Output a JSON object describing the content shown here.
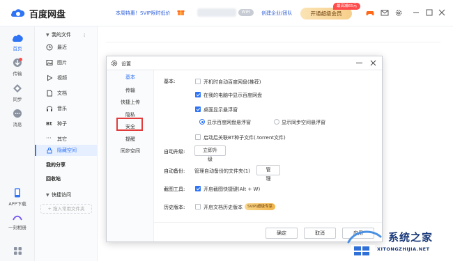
{
  "app": {
    "title": "百度网盘",
    "promo": "本周特惠！SVIP限时低价",
    "wifi_badge": "WIFI",
    "enterprise_link": "创建企业/团队",
    "vip_button": "开通超级会员",
    "discount_badge": "最高减65元",
    "accent_color": "#2f74f5"
  },
  "rail": {
    "items": [
      {
        "label": "首页",
        "icon": "cloud-icon"
      },
      {
        "label": "传输",
        "icon": "transfer-icon"
      },
      {
        "label": "同步",
        "icon": "sync-icon"
      },
      {
        "label": "消息",
        "icon": "message-icon"
      }
    ],
    "bottom": [
      {
        "label": "APP下载",
        "icon": "phone-icon"
      },
      {
        "label": "一刻相册",
        "icon": "album-icon"
      },
      {
        "label": "",
        "icon": "apps-grid-icon"
      }
    ]
  },
  "nav": {
    "my_files": "我的文件",
    "items": [
      {
        "label": "最近",
        "icon": "clock-icon"
      },
      {
        "label": "图片",
        "icon": "image-icon"
      },
      {
        "label": "视频",
        "icon": "play-icon"
      },
      {
        "label": "文档",
        "icon": "document-icon"
      },
      {
        "label": "音乐",
        "icon": "headphone-icon"
      },
      {
        "label": "种子",
        "icon": "bt-icon"
      },
      {
        "label": "其它",
        "icon": "more-icon"
      },
      {
        "label": "隐藏空间",
        "icon": "lock-icon"
      }
    ],
    "my_share": "我的分享",
    "recycle": "回收站",
    "quick_access": "快捷访问",
    "add_common": "+ 拖入常用文件夹"
  },
  "dialog": {
    "title": "设置",
    "nav_items": [
      "基本",
      "传输",
      "快捷上传",
      "隐私",
      "安全",
      "提醒",
      "同步空间"
    ],
    "active_nav": "基本",
    "basic_label": "基本:",
    "options": [
      {
        "text": "开机时自动百度网盘(推荐)",
        "checked": false
      },
      {
        "text": "在我的电脑中显示百度网盘",
        "checked": true
      },
      {
        "text": "桌面显示悬浮窗",
        "checked": true
      }
    ],
    "float_radios": [
      {
        "text": "显示百度网盘悬浮窗",
        "checked": true
      },
      {
        "text": "显示同步空间悬浮窗",
        "checked": false
      }
    ],
    "bt_option": {
      "text": "启动后关联BT种子文件(.torrent文件)",
      "checked": false
    },
    "auto_upgrade_label": "自动升级:",
    "upgrade_button": "立即升级",
    "auto_backup_label": "自动备份:",
    "backup_text": "管理自动备份的文件夹(1)",
    "manage_button": "管理",
    "screenshot_label": "截图工具:",
    "screenshot_option": {
      "text": "开启截图快捷键(Alt + W)",
      "checked": true
    },
    "history_label": "历史版本:",
    "history_option": {
      "text": "开启文档历史版本",
      "checked": false
    },
    "svip_tag": "SVIP/超级专享",
    "ok_button": "确定",
    "cancel_button": "取消",
    "apply_button": "应用"
  },
  "watermark": {
    "text": "系统之家",
    "sub": "XITONGZHIJIA.NET"
  }
}
